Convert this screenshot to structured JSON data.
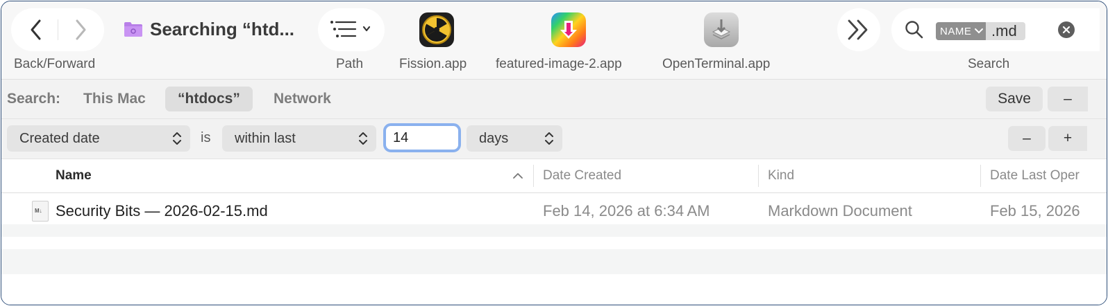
{
  "toolbar": {
    "nav_label": "Back/Forward",
    "window_title": "Searching “htd...",
    "path_label": "Path",
    "apps": [
      {
        "label": "Fission.app",
        "icon": "radiation-icon"
      },
      {
        "label": "featured-image-2.app",
        "icon": "download-arrow-icon"
      },
      {
        "label": "OpenTerminal.app",
        "icon": "terminal-icon"
      }
    ],
    "search_label": "Search",
    "search_token": "NAME",
    "search_value": ".md"
  },
  "scope": {
    "label": "Search:",
    "options": [
      "This Mac",
      "“htdocs”",
      "Network"
    ],
    "selected": "“htdocs”",
    "save_label": "Save",
    "remove_label": "–"
  },
  "criteria": {
    "attribute": "Created date",
    "operator_label": "is",
    "condition": "within last",
    "value": "14",
    "unit": "days",
    "remove_label": "–",
    "add_label": "+"
  },
  "table": {
    "columns": [
      "Name",
      "Date Created",
      "Kind",
      "Date Last Oper"
    ],
    "rows": [
      {
        "name": "Security Bits — 2026-02-15.md",
        "icon_text": "M↓",
        "date_created": "Feb 14, 2026 at 6:34 AM",
        "kind": "Markdown Document",
        "date_last_opened": "Feb 15, 2026"
      }
    ]
  },
  "colors": {
    "accent_focus": "#8ab1ee",
    "window_border": "#2f4f7a",
    "folder_purple": "#b87fe8"
  }
}
